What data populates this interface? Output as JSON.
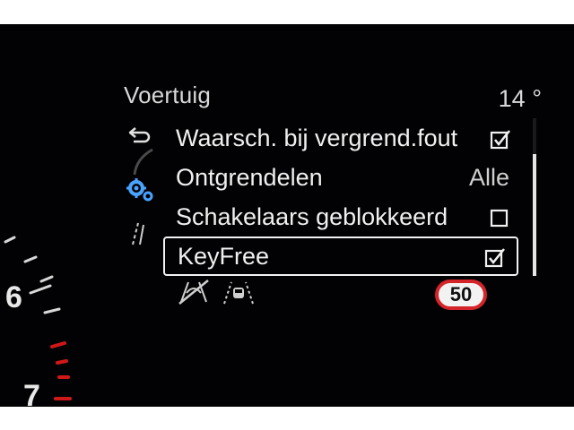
{
  "header": {
    "title": "Voertuig",
    "temperature": "14 °"
  },
  "menu": {
    "items": [
      {
        "label": "Waarsch. bij vergrend.fout",
        "control": "checkbox",
        "checked": true
      },
      {
        "label": "Ontgrendelen",
        "value": "Alle"
      },
      {
        "label": "Schakelaars geblokkeerd",
        "control": "checkbox",
        "checked": false
      },
      {
        "label": "KeyFree",
        "control": "checkbox",
        "checked": true,
        "selected": true
      }
    ]
  },
  "side_icons": [
    "back-arrow-icon",
    "gear-icon",
    "lane-icon"
  ],
  "status": {
    "icons": [
      "traction-off-icon",
      "lane-assist-icon"
    ],
    "speed_limit": "50"
  },
  "gauge": {
    "numbers": [
      "6",
      "7"
    ]
  },
  "colors": {
    "background": "#020204",
    "text": "#f0f0f0",
    "accent_blue": "#4aa3ff",
    "red": "#d4242a"
  }
}
